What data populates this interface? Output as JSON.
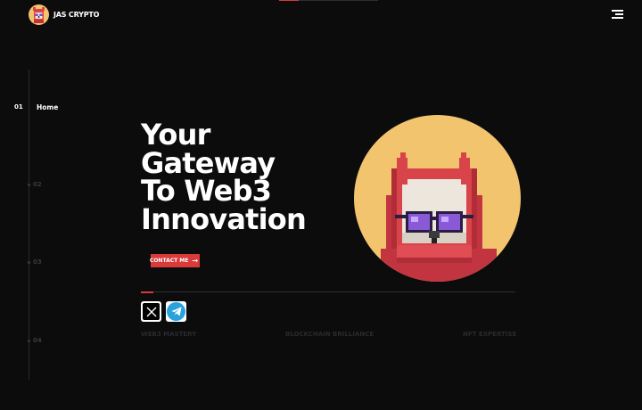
{
  "header": {
    "brand": "JAS CRYPTO",
    "logo_icon": "owl-logo-icon",
    "menu_icon": "hamburger-menu-icon"
  },
  "nav": {
    "items": [
      {
        "num": "01",
        "label": "Home",
        "active": true
      },
      {
        "num": "02",
        "label": "",
        "active": false
      },
      {
        "num": "03",
        "label": "",
        "active": false
      },
      {
        "num": "04",
        "label": "",
        "active": false
      }
    ]
  },
  "hero": {
    "headline": [
      "Your",
      "Gateway",
      "To Web3",
      "Innovation"
    ],
    "cta_label": "CONTACT ME",
    "cta_icon": "arrow-right-icon",
    "avatar_icon": "pixel-owl-avatar"
  },
  "socials": [
    {
      "name": "X",
      "icon": "x-twitter-icon"
    },
    {
      "name": "Telegram",
      "icon": "telegram-icon"
    }
  ],
  "features": [
    "WEB3 MASTERY",
    "BLOCKCHAIN BRILLIANCE",
    "NFT EXPERTISE"
  ],
  "colors": {
    "background": "#0c0c0d",
    "accent": "#d93a3a",
    "avatar_bg": "#f2c46e",
    "text": "#ffffff",
    "muted": "#3a3a3c"
  }
}
